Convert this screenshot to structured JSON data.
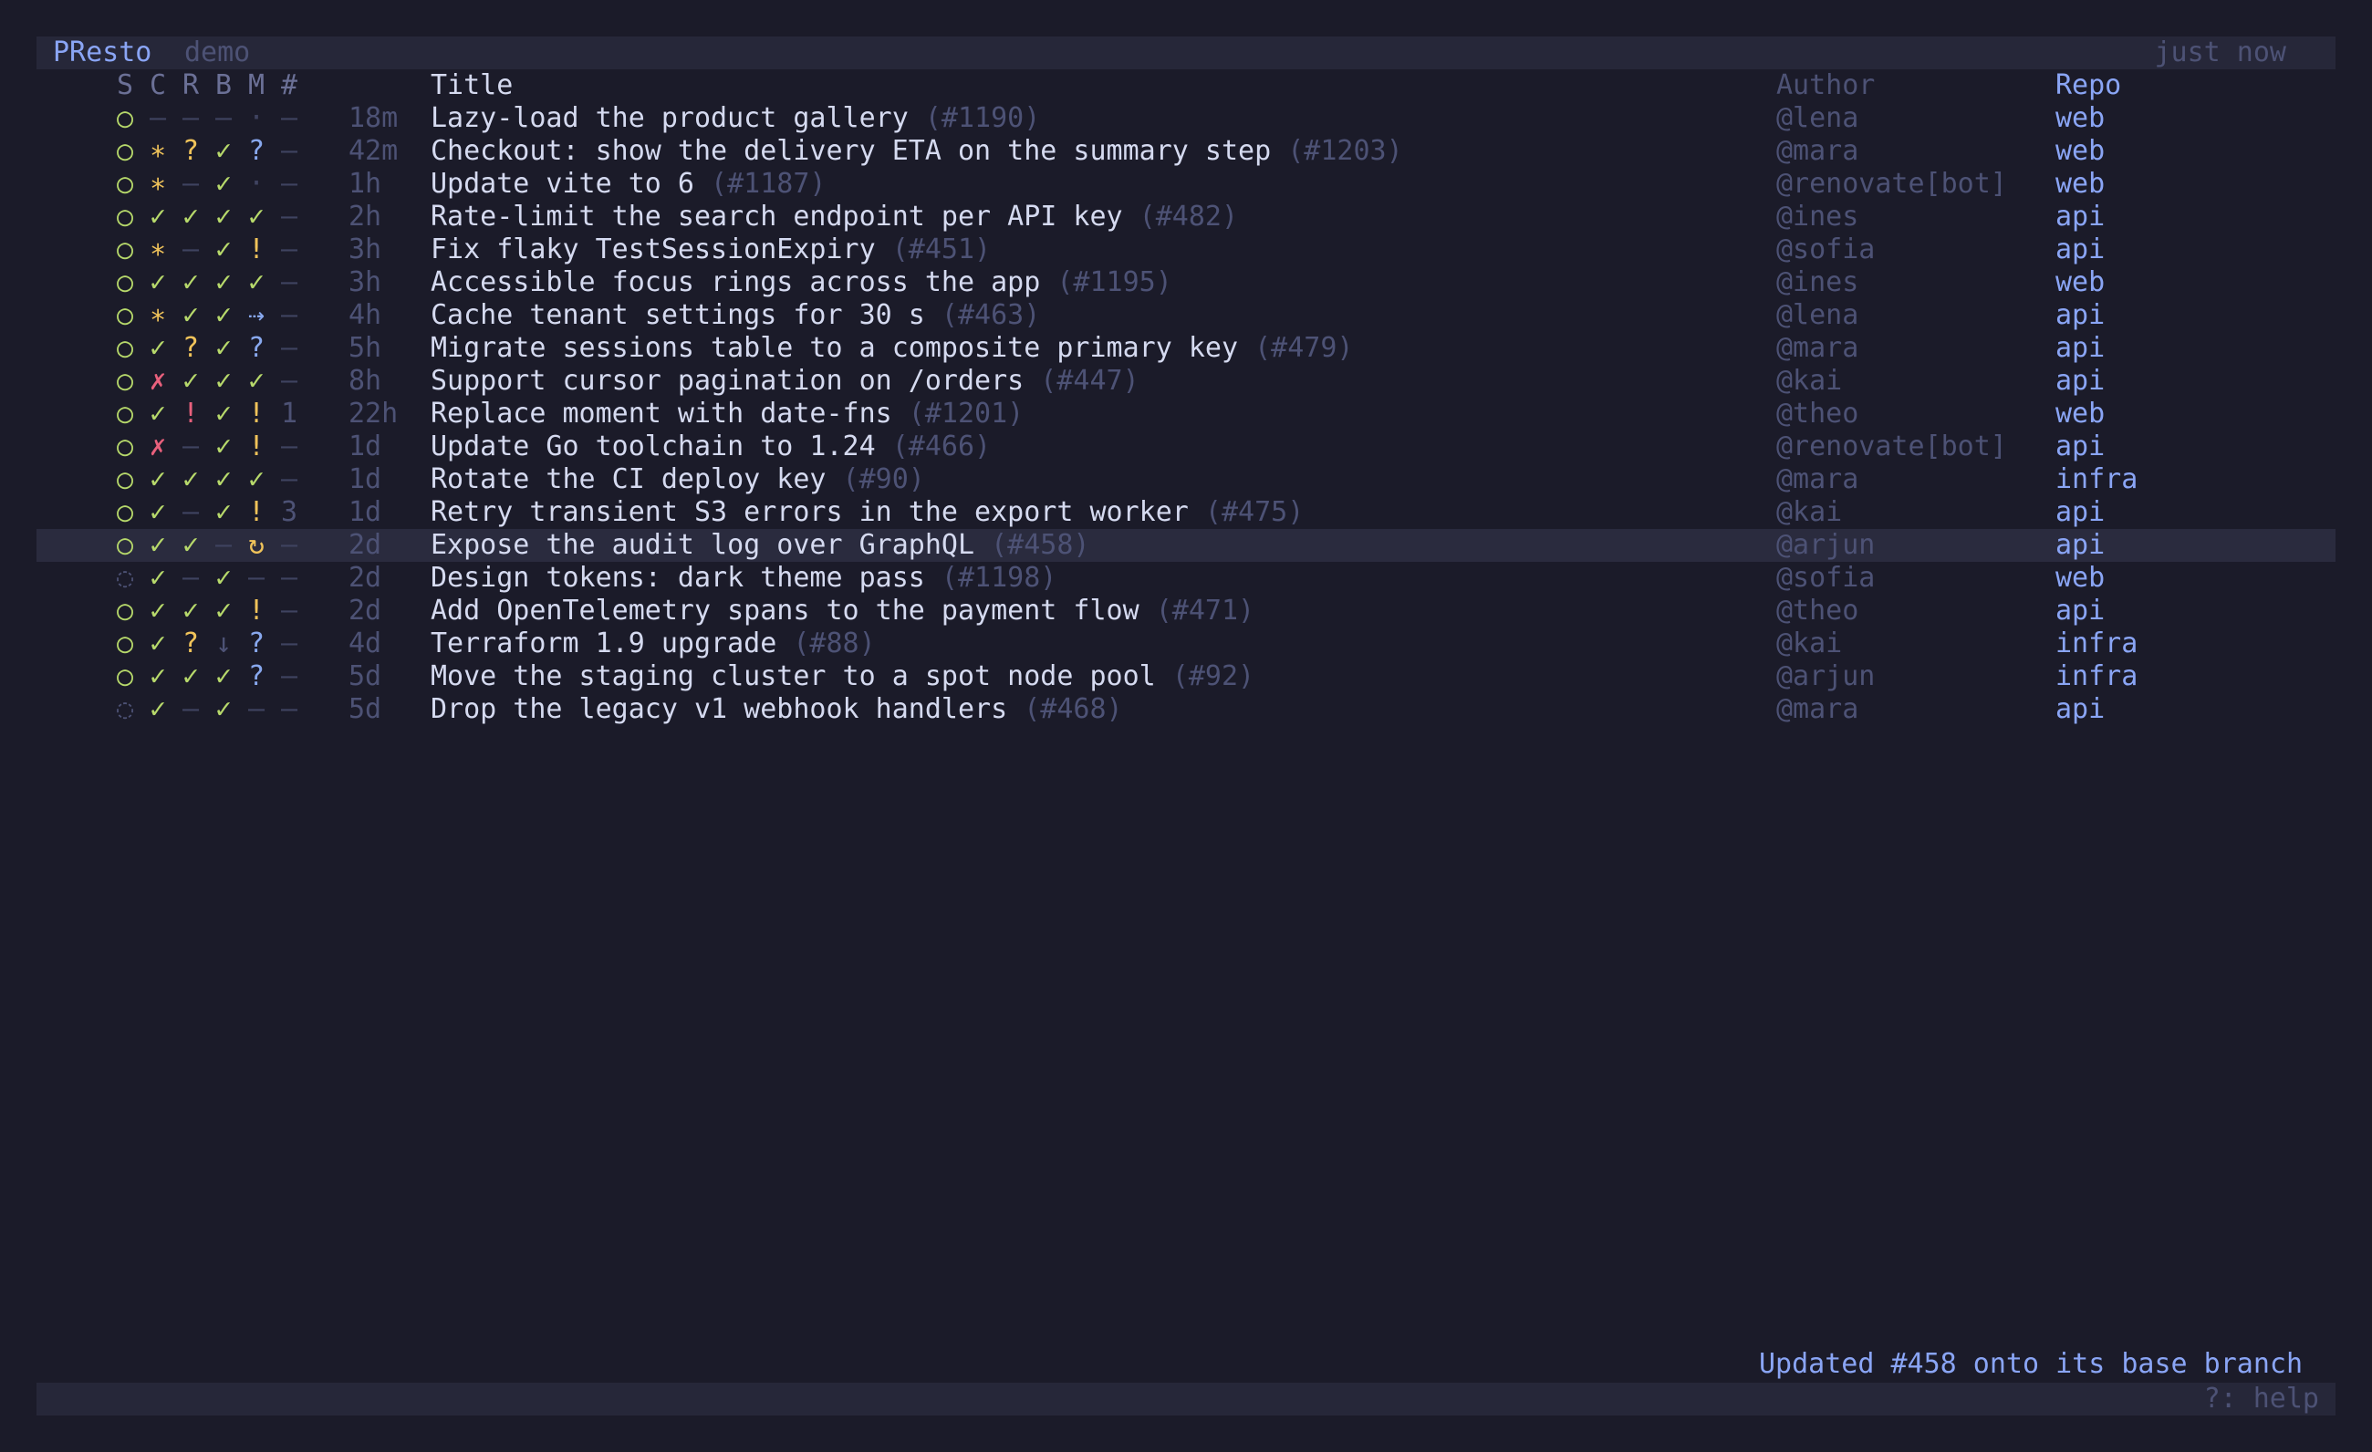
{
  "app": {
    "name": "PResto",
    "environment": "demo",
    "refreshed": "just now"
  },
  "columns": {
    "status": "S",
    "ci": "C",
    "review": "R",
    "branch": "B",
    "merge": "M",
    "comments": "#",
    "title": "Title",
    "author": "Author",
    "repo": "Repo"
  },
  "colors": {
    "background": "#1b1b29",
    "bar": "#262739",
    "selected_row": "#2a2b3e",
    "accent": "#8aa5f5",
    "green": "#b7d96b",
    "yellow": "#f0c35a",
    "red": "#e8607c",
    "blue": "#88a8ee",
    "dim": "#4d5275"
  },
  "rows": [
    {
      "s": "○",
      "s_c": "green",
      "c": "–",
      "c_c": "dim",
      "r": "–",
      "r_c": "dim",
      "b": "–",
      "b_c": "dim",
      "m": "·",
      "m_c": "dim",
      "n": "–",
      "n_c": "dim",
      "age": "18m",
      "title": "Lazy-load the product gallery",
      "num": "(#1190)",
      "author": "@lena",
      "repo": "web"
    },
    {
      "s": "○",
      "s_c": "green",
      "c": "∗",
      "c_c": "yellow",
      "r": "?",
      "r_c": "yellow",
      "b": "✓",
      "b_c": "green",
      "m": "?",
      "m_c": "blue",
      "n": "–",
      "n_c": "dim",
      "age": "42m",
      "title": "Checkout: show the delivery ETA on the summary step",
      "num": "(#1203)",
      "author": "@mara",
      "repo": "web"
    },
    {
      "s": "○",
      "s_c": "green",
      "c": "∗",
      "c_c": "yellow",
      "r": "–",
      "r_c": "dim",
      "b": "✓",
      "b_c": "green",
      "m": "·",
      "m_c": "dim",
      "n": "–",
      "n_c": "dim",
      "age": "1h",
      "title": "Update vite to 6",
      "num": "(#1187)",
      "author": "@renovate[bot]",
      "repo": "web"
    },
    {
      "s": "○",
      "s_c": "green",
      "c": "✓",
      "c_c": "green",
      "r": "✓",
      "r_c": "green",
      "b": "✓",
      "b_c": "green",
      "m": "✓",
      "m_c": "green",
      "n": "–",
      "n_c": "dim",
      "age": "2h",
      "title": "Rate-limit the search endpoint per API key",
      "num": "(#482)",
      "author": "@ines",
      "repo": "api"
    },
    {
      "s": "○",
      "s_c": "green",
      "c": "∗",
      "c_c": "yellow",
      "r": "–",
      "r_c": "dim",
      "b": "✓",
      "b_c": "green",
      "m": "!",
      "m_c": "yellow",
      "n": "–",
      "n_c": "dim",
      "age": "3h",
      "title": "Fix flaky TestSessionExpiry",
      "num": "(#451)",
      "author": "@sofia",
      "repo": "api"
    },
    {
      "s": "○",
      "s_c": "green",
      "c": "✓",
      "c_c": "green",
      "r": "✓",
      "r_c": "green",
      "b": "✓",
      "b_c": "green",
      "m": "✓",
      "m_c": "green",
      "n": "–",
      "n_c": "dim",
      "age": "3h",
      "title": "Accessible focus rings across the app",
      "num": "(#1195)",
      "author": "@ines",
      "repo": "web"
    },
    {
      "s": "○",
      "s_c": "green",
      "c": "∗",
      "c_c": "yellow",
      "r": "✓",
      "r_c": "green",
      "b": "✓",
      "b_c": "green",
      "m": "⇢",
      "m_c": "blue",
      "n": "–",
      "n_c": "dim",
      "age": "4h",
      "title": "Cache tenant settings for 30 s",
      "num": "(#463)",
      "author": "@lena",
      "repo": "api"
    },
    {
      "s": "○",
      "s_c": "green",
      "c": "✓",
      "c_c": "green",
      "r": "?",
      "r_c": "yellow",
      "b": "✓",
      "b_c": "green",
      "m": "?",
      "m_c": "blue",
      "n": "–",
      "n_c": "dim",
      "age": "5h",
      "title": "Migrate sessions table to a composite primary key",
      "num": "(#479)",
      "author": "@mara",
      "repo": "api"
    },
    {
      "s": "○",
      "s_c": "green",
      "c": "✗",
      "c_c": "red",
      "r": "✓",
      "r_c": "green",
      "b": "✓",
      "b_c": "green",
      "m": "✓",
      "m_c": "green",
      "n": "–",
      "n_c": "dim",
      "age": "8h",
      "title": "Support cursor pagination on /orders",
      "num": "(#447)",
      "author": "@kai",
      "repo": "api"
    },
    {
      "s": "○",
      "s_c": "green",
      "c": "✓",
      "c_c": "green",
      "r": "!",
      "r_c": "red",
      "b": "✓",
      "b_c": "green",
      "m": "!",
      "m_c": "yellow",
      "n": "1",
      "n_c": "gray",
      "age": "22h",
      "title": "Replace moment with date-fns",
      "num": "(#1201)",
      "author": "@theo",
      "repo": "web"
    },
    {
      "s": "○",
      "s_c": "green",
      "c": "✗",
      "c_c": "red",
      "r": "–",
      "r_c": "dim",
      "b": "✓",
      "b_c": "green",
      "m": "!",
      "m_c": "yellow",
      "n": "–",
      "n_c": "dim",
      "age": "1d",
      "title": "Update Go toolchain to 1.24",
      "num": "(#466)",
      "author": "@renovate[bot]",
      "repo": "api"
    },
    {
      "s": "○",
      "s_c": "green",
      "c": "✓",
      "c_c": "green",
      "r": "✓",
      "r_c": "green",
      "b": "✓",
      "b_c": "green",
      "m": "✓",
      "m_c": "green",
      "n": "–",
      "n_c": "dim",
      "age": "1d",
      "title": "Rotate the CI deploy key",
      "num": "(#90)",
      "author": "@mara",
      "repo": "infra"
    },
    {
      "s": "○",
      "s_c": "green",
      "c": "✓",
      "c_c": "green",
      "r": "–",
      "r_c": "dim",
      "b": "✓",
      "b_c": "green",
      "m": "!",
      "m_c": "yellow",
      "n": "3",
      "n_c": "gray",
      "age": "1d",
      "title": "Retry transient S3 errors in the export worker",
      "num": "(#475)",
      "author": "@kai",
      "repo": "api"
    },
    {
      "s": "○",
      "s_c": "green",
      "c": "✓",
      "c_c": "green",
      "r": "✓",
      "r_c": "green",
      "b": "–",
      "b_c": "dim",
      "m": "↻",
      "m_c": "yellow",
      "n": "–",
      "n_c": "dim",
      "age": "2d",
      "title": "Expose the audit log over GraphQL",
      "num": "(#458)",
      "author": "@arjun",
      "repo": "api",
      "selected": true
    },
    {
      "s": "◌",
      "s_c": "gray",
      "c": "✓",
      "c_c": "green",
      "r": "–",
      "r_c": "dim",
      "b": "✓",
      "b_c": "green",
      "m": "–",
      "m_c": "dim",
      "n": "–",
      "n_c": "dim",
      "age": "2d",
      "title": "Design tokens: dark theme pass",
      "num": "(#1198)",
      "author": "@sofia",
      "repo": "web"
    },
    {
      "s": "○",
      "s_c": "green",
      "c": "✓",
      "c_c": "green",
      "r": "✓",
      "r_c": "green",
      "b": "✓",
      "b_c": "green",
      "m": "!",
      "m_c": "yellow",
      "n": "–",
      "n_c": "dim",
      "age": "2d",
      "title": "Add OpenTelemetry spans to the payment flow",
      "num": "(#471)",
      "author": "@theo",
      "repo": "api"
    },
    {
      "s": "○",
      "s_c": "green",
      "c": "✓",
      "c_c": "green",
      "r": "?",
      "r_c": "yellow",
      "b": "↓",
      "b_c": "gray",
      "m": "?",
      "m_c": "blue",
      "n": "–",
      "n_c": "dim",
      "age": "4d",
      "title": "Terraform 1.9 upgrade",
      "num": "(#88)",
      "author": "@kai",
      "repo": "infra"
    },
    {
      "s": "○",
      "s_c": "green",
      "c": "✓",
      "c_c": "green",
      "r": "✓",
      "r_c": "green",
      "b": "✓",
      "b_c": "green",
      "m": "?",
      "m_c": "blue",
      "n": "–",
      "n_c": "dim",
      "age": "5d",
      "title": "Move the staging cluster to a spot node pool",
      "num": "(#92)",
      "author": "@arjun",
      "repo": "infra"
    },
    {
      "s": "◌",
      "s_c": "gray",
      "c": "✓",
      "c_c": "green",
      "r": "–",
      "r_c": "dim",
      "b": "✓",
      "b_c": "green",
      "m": "–",
      "m_c": "dim",
      "n": "–",
      "n_c": "dim",
      "age": "5d",
      "title": "Drop the legacy v1 webhook handlers",
      "num": "(#468)",
      "author": "@mara",
      "repo": "api"
    }
  ],
  "flash": "Updated #458 onto its base branch",
  "help": "?: help"
}
